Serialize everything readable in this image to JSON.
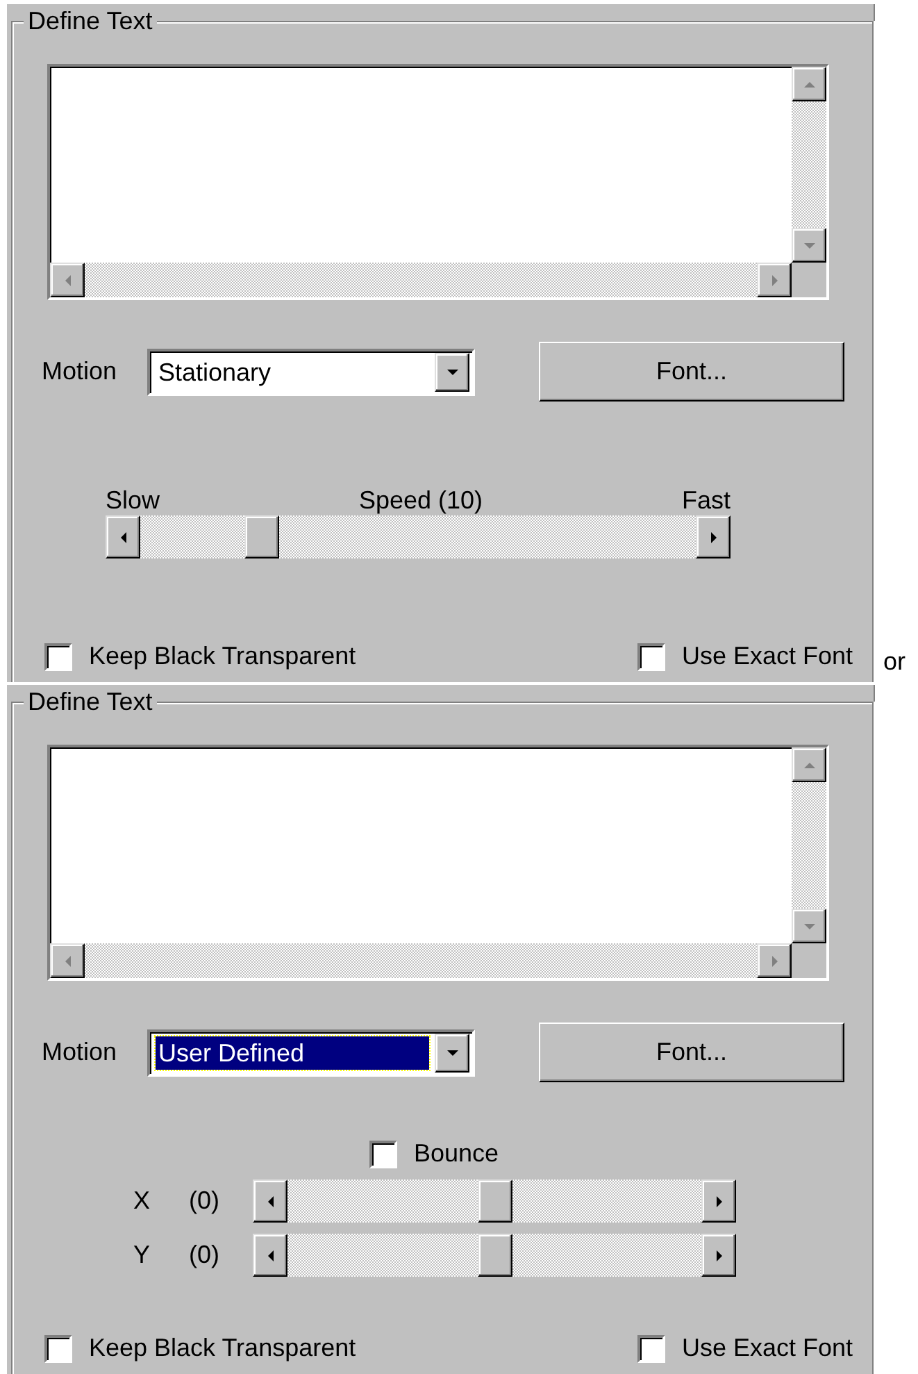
{
  "panels": [
    {
      "group_title": "Define Text",
      "motion": {
        "label": "Motion",
        "value": "Stationary",
        "focused": false
      },
      "font_button": "Font...",
      "controls": [
        {
          "kind": "speed",
          "min_label": "Slow",
          "title": "Speed (10)",
          "max_label": "Fast",
          "level": 0.2
        }
      ],
      "checkboxes": [
        {
          "label": "Keep Black Transparent",
          "checked": false
        },
        {
          "label": "Use Exact Font",
          "checked": false
        }
      ],
      "suffix": "or"
    },
    {
      "group_title": "Define Text",
      "motion": {
        "label": "Motion",
        "value": "User Defined",
        "focused": true
      },
      "font_button": "Font...",
      "controls": [
        {
          "kind": "checkbox",
          "label": "Bounce",
          "checked": false
        },
        {
          "kind": "axis",
          "axis": "X",
          "reading": "(0)",
          "level": 0.5
        },
        {
          "kind": "axis",
          "axis": "Y",
          "reading": "(0)",
          "level": 0.5
        }
      ],
      "checkboxes": [
        {
          "label": "Keep Black Transparent",
          "checked": false
        },
        {
          "label": "Use Exact Font",
          "checked": false
        }
      ]
    }
  ]
}
